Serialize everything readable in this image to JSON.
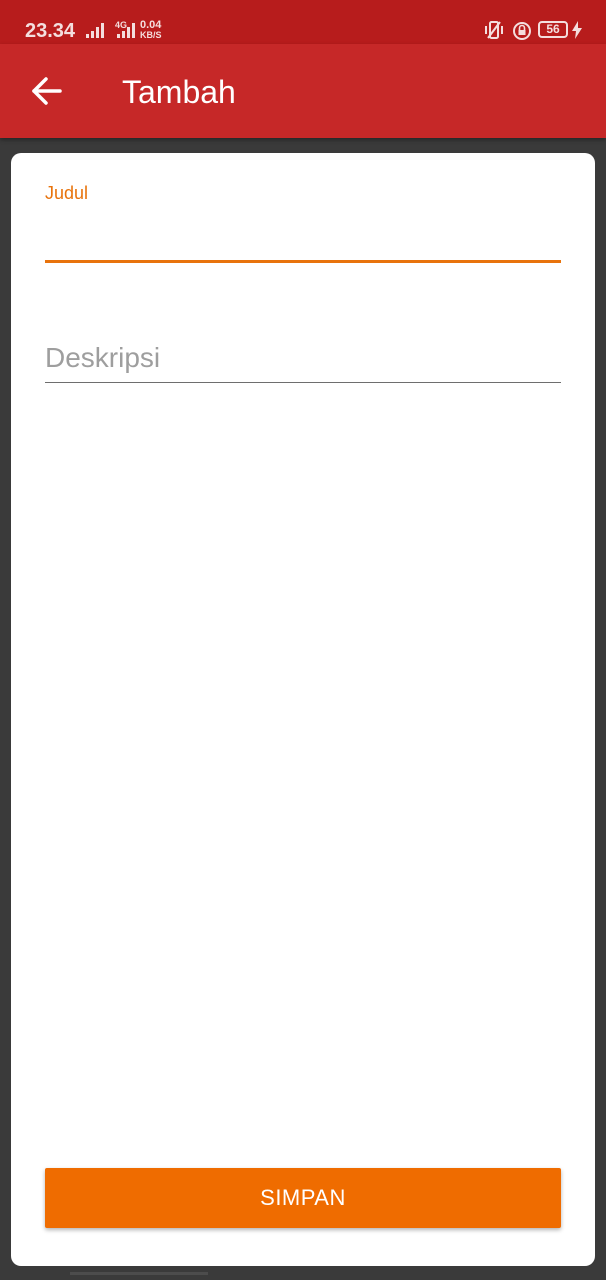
{
  "status_bar": {
    "time": "23.34",
    "network_type": "4G",
    "speed_value": "0.04",
    "speed_unit": "KB/S",
    "battery_level": "56",
    "icons": [
      "signal-icon",
      "signal-4g-icon",
      "vibrate-icon",
      "rotation-lock-icon",
      "battery-icon",
      "charging-icon"
    ]
  },
  "app_bar": {
    "back_icon": "arrow-left-icon",
    "title": "Tambah",
    "color": "#c62828"
  },
  "form": {
    "judul": {
      "label": "Judul",
      "value": ""
    },
    "deskripsi": {
      "placeholder": "Deskripsi",
      "value": ""
    },
    "accent_color": "#e8730c",
    "save_button": {
      "label": "SIMPAN",
      "color": "#ef6c00"
    }
  }
}
